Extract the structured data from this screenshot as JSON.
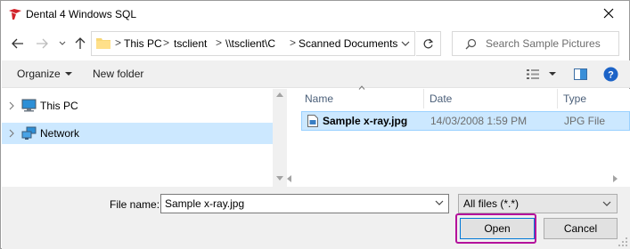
{
  "window": {
    "title": "Dental 4 Windows SQL"
  },
  "address": {
    "crumbs": [
      "This PC",
      "tsclient",
      "\\\\tsclient\\C",
      "Scanned Documents"
    ],
    "separator": ">"
  },
  "search": {
    "placeholder": "Search Sample Pictures"
  },
  "toolbar": {
    "organize_label": "Organize",
    "new_folder_label": "New folder"
  },
  "nav_tree": {
    "items": [
      {
        "label": "This PC",
        "icon": "computer-icon"
      },
      {
        "label": "Network",
        "icon": "network-icon"
      }
    ]
  },
  "columns": {
    "name": "Name",
    "date": "Date",
    "type": "Type"
  },
  "files": [
    {
      "name": "Sample x-ray.jpg",
      "date": "14/03/2008 1:59 PM",
      "type": "JPG File"
    }
  ],
  "bottom": {
    "filename_label": "File name:",
    "filename_value": "Sample x-ray.jpg",
    "filter_value": "All files (*.*)",
    "open_label": "Open",
    "cancel_label": "Cancel"
  },
  "colors": {
    "selection": "#cce8ff",
    "highlight_ring": "#b4129c",
    "accent": "#0078d7"
  }
}
